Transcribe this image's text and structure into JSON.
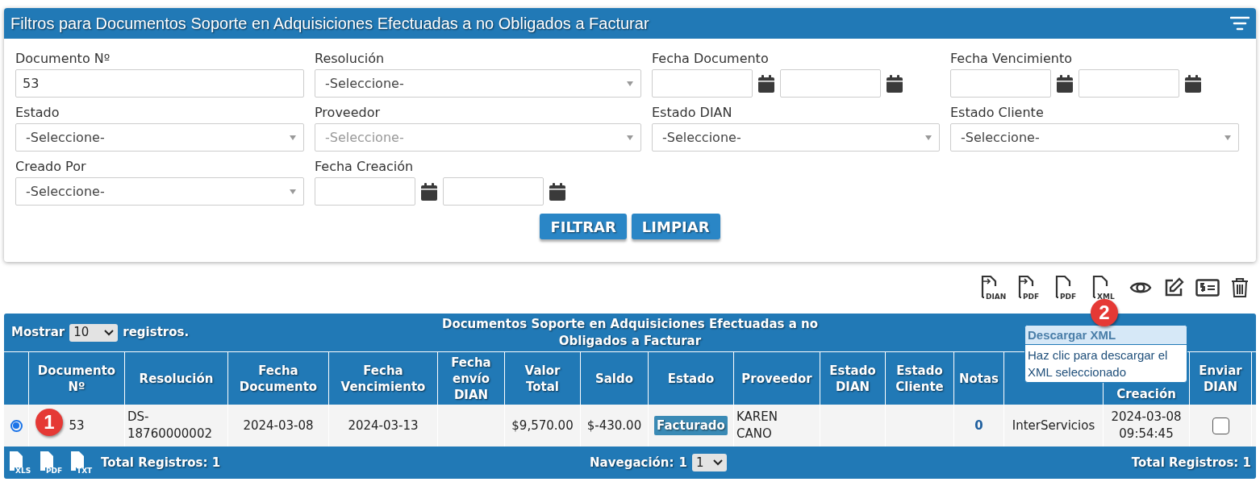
{
  "filters": {
    "title": "Filtros para Documentos Soporte en Adquisiciones Efectuadas a no Obligados a Facturar",
    "fields": [
      {
        "label": "Documento Nº",
        "kind": "text",
        "value": "53"
      },
      {
        "label": "Resolución",
        "kind": "select",
        "value": "-Seleccione-",
        "disabled": false
      },
      {
        "label": "Fecha Documento",
        "kind": "daterange"
      },
      {
        "label": "Fecha Vencimiento",
        "kind": "daterange"
      },
      {
        "label": "Estado",
        "kind": "select",
        "value": "-Seleccione-",
        "disabled": false
      },
      {
        "label": "Proveedor",
        "kind": "select",
        "value": "-Seleccione-",
        "disabled": true
      },
      {
        "label": "Estado DIAN",
        "kind": "select",
        "value": "-Seleccione-",
        "disabled": false
      },
      {
        "label": "Estado Cliente",
        "kind": "select",
        "value": "-Seleccione-",
        "disabled": false
      },
      {
        "label": "Creado Por",
        "kind": "select",
        "value": "-Seleccione-",
        "disabled": false
      },
      {
        "label": "Fecha Creación",
        "kind": "daterange"
      }
    ],
    "buttons": [
      "FILTRAR",
      "LIMPIAR"
    ]
  },
  "toolbar": [
    {
      "kind": "file-arrow",
      "label": "DIAN"
    },
    {
      "kind": "file-arrow",
      "label": "PDF"
    },
    {
      "kind": "file",
      "label": "PDF"
    },
    {
      "kind": "file",
      "label": "XML"
    },
    {
      "kind": "eye"
    },
    {
      "kind": "edit"
    },
    {
      "kind": "money"
    },
    {
      "kind": "trash"
    }
  ],
  "tooltip": {
    "title": "Descargar XML",
    "body": "Haz clic para descargar el XML seleccionado"
  },
  "markers": [
    {
      "label": "1"
    },
    {
      "label": "2"
    }
  ],
  "table": {
    "show_label": "Mostrar",
    "page_size": "10",
    "show_suffix": "registros.",
    "title": "Documentos Soporte en Adquisiciones Efectuadas a no Obligados a Facturar",
    "columns": [
      "",
      "Documento Nº",
      "Resolución",
      "Fecha Documento",
      "Fecha Vencimiento",
      "Fecha envío DIAN",
      "Valor Total",
      "Saldo",
      "Estado",
      "Proveedor",
      "Estado DIAN",
      "Estado Cliente",
      "Notas",
      "",
      "Creación",
      "Enviar DIAN"
    ],
    "rows": [
      {
        "cells": [
          {
            "kind": "radio",
            "selected": true
          },
          {
            "kind": "text",
            "text": "53"
          },
          {
            "kind": "text",
            "text": "DS-18760000002"
          },
          {
            "kind": "text",
            "text": "2024-03-08"
          },
          {
            "kind": "text",
            "text": "2024-03-13"
          },
          {
            "kind": "empty"
          },
          {
            "kind": "text",
            "text": "$9,570.00"
          },
          {
            "kind": "text",
            "text": "$-430.00"
          },
          {
            "kind": "badge",
            "text": "Facturado"
          },
          {
            "kind": "text",
            "text": "KAREN CANO"
          },
          {
            "kind": "empty"
          },
          {
            "kind": "empty"
          },
          {
            "kind": "link",
            "text": "0"
          },
          {
            "kind": "text",
            "text": "InterServicios"
          },
          {
            "kind": "text",
            "text": "2024-03-08 09:54:45"
          },
          {
            "kind": "checkbox",
            "checked": false
          }
        ]
      }
    ],
    "footer": {
      "exports": [
        "XLS",
        "PDF",
        "TXT"
      ],
      "total_left": "Total Registros: 1",
      "nav_label": "Navegación:",
      "page": "1",
      "page_select": "1",
      "total_right": "Total Registros: 1"
    }
  }
}
